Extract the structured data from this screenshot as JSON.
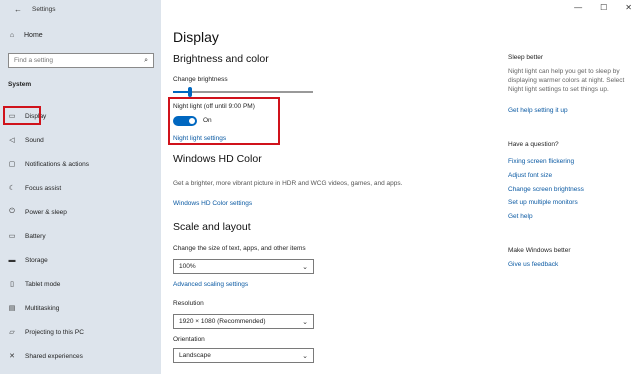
{
  "window": {
    "title": "Settings",
    "back_icon": "back-arrow-icon",
    "controls": [
      "—",
      "☐",
      "✕"
    ]
  },
  "sidebar": {
    "home_label": "Home",
    "search_placeholder": "Find a setting",
    "section_label": "System",
    "items": [
      {
        "label": "Display",
        "icon": "monitor-icon",
        "glyph": "▭"
      },
      {
        "label": "Sound",
        "icon": "speaker-icon",
        "glyph": "◁"
      },
      {
        "label": "Notifications & actions",
        "icon": "notification-icon",
        "glyph": "▢"
      },
      {
        "label": "Focus assist",
        "icon": "moon-icon",
        "glyph": "☾"
      },
      {
        "label": "Power & sleep",
        "icon": "power-icon",
        "glyph": "⏻"
      },
      {
        "label": "Battery",
        "icon": "battery-icon",
        "glyph": "▭"
      },
      {
        "label": "Storage",
        "icon": "storage-icon",
        "glyph": "▬"
      },
      {
        "label": "Tablet mode",
        "icon": "tablet-icon",
        "glyph": "▯"
      },
      {
        "label": "Multitasking",
        "icon": "multitasking-icon",
        "glyph": "▤"
      },
      {
        "label": "Projecting to this PC",
        "icon": "projector-icon",
        "glyph": "▱"
      },
      {
        "label": "Shared experiences",
        "icon": "shared-icon",
        "glyph": "✕"
      }
    ]
  },
  "main": {
    "title": "Display",
    "brightness": {
      "heading": "Brightness and color",
      "change_label": "Change brightness",
      "level": 0.12
    },
    "night_light": {
      "label": "Night light (off until 9:00 PM)",
      "toggle_state": "On",
      "settings_link": "Night light settings"
    },
    "hd_color": {
      "heading": "Windows HD Color",
      "desc": "Get a brighter, more vibrant picture in HDR and WCG videos, games, and apps.",
      "link": "Windows HD Color settings"
    },
    "scale": {
      "heading": "Scale and layout",
      "size_label": "Change the size of text, apps, and other items",
      "size_value": "100%",
      "advanced_link": "Advanced scaling settings",
      "resolution_label": "Resolution",
      "resolution_value": "1920 × 1080 (Recommended)",
      "orientation_label": "Orientation",
      "orientation_value": "Landscape"
    }
  },
  "right": {
    "sleep_heading": "Sleep better",
    "sleep_text": "Night light can help you get to sleep by displaying warmer colors at night. Select Night light settings to set things up.",
    "sleep_link": "Get help setting it up",
    "question_heading": "Have a question?",
    "question_links": [
      "Fixing screen flickering",
      "Adjust font size",
      "Change screen brightness",
      "Set up multiple monitors",
      "Get help"
    ],
    "better_heading": "Make Windows better",
    "better_link": "Give us feedback"
  },
  "colors": {
    "accent": "#0067c0",
    "highlight": "#d0121b",
    "sidebar_bg": "#dde4ec"
  }
}
